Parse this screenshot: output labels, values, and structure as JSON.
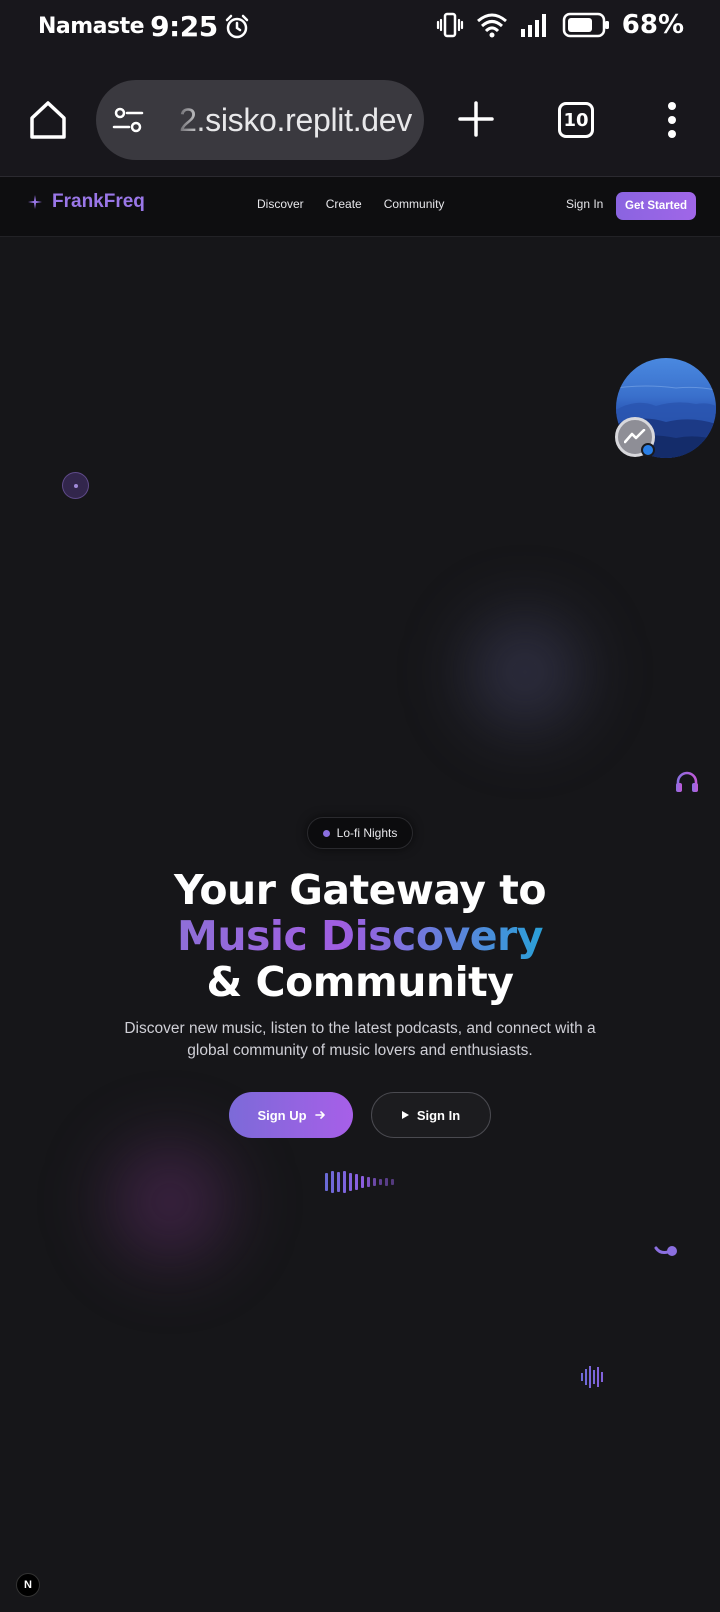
{
  "status_bar": {
    "greeting": "Namaste",
    "time": "9:25",
    "battery": "68%"
  },
  "browser": {
    "url": "2.sisko.replit.dev",
    "tab_count": "10"
  },
  "site": {
    "logo_text": "FrankFreq",
    "nav": [
      "Discover",
      "Create",
      "Community"
    ],
    "sign_in": "Sign In",
    "get_started": "Get Started"
  },
  "hero": {
    "badge": "Lo-fi Nights",
    "title_line1": "Your Gateway to",
    "title_accent": "Music Discovery",
    "title_line3": "& Community",
    "subtitle": "Discover new music, listen to the latest podcasts, and connect with a global community of music lovers and enthusiasts.",
    "signup_label": "Sign Up",
    "signin_label": "Sign In"
  },
  "footer": {
    "next_badge": "N"
  },
  "colors": {
    "accent_purple": "#8b6fe0",
    "accent_blue": "#2aa0d8",
    "background": "#161619"
  }
}
